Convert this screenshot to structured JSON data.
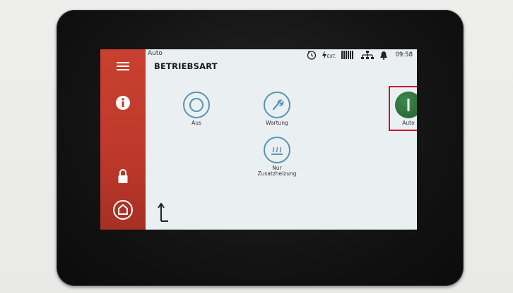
{
  "header": {
    "mode": "Auto",
    "title": "BETRIEBSART",
    "time": "09:58",
    "ext_label": "EXT."
  },
  "sidebar": {
    "items": [
      {
        "name": "menu",
        "icon": "hamburger-icon"
      },
      {
        "name": "info",
        "icon": "info-icon"
      },
      {
        "name": "lock",
        "icon": "lock-icon"
      },
      {
        "name": "home",
        "icon": "home-icon"
      }
    ]
  },
  "operating_modes": [
    {
      "label": "Aus",
      "icon": "off-ring-icon"
    },
    {
      "label": "Wartung",
      "icon": "wrench-icon"
    },
    {
      "label": "Auto",
      "icon": "power-on-icon",
      "selected": true
    },
    {
      "label": "Nur Zusatzheizung",
      "icon": "heater-icon"
    }
  ],
  "colors": {
    "sidebar": "#c0392b",
    "icon_ring": "#5a93b3",
    "active": "#2f7a3e",
    "highlight": "#c8102e"
  }
}
